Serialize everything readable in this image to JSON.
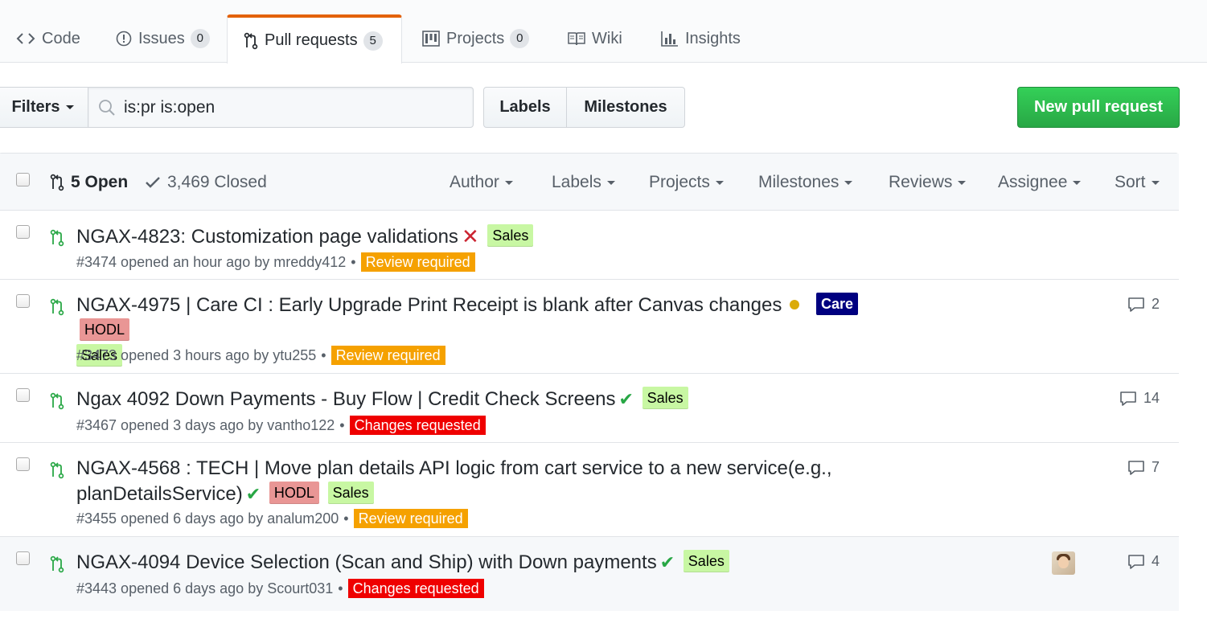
{
  "tabs": [
    {
      "label": "Code",
      "icon": "code-icon",
      "counter": null
    },
    {
      "label": "Issues",
      "icon": "issue-opened-icon",
      "counter": "0"
    },
    {
      "label": "Pull requests",
      "icon": "git-pull-request-icon",
      "counter": "5"
    },
    {
      "label": "Projects",
      "icon": "project-icon",
      "counter": "0"
    },
    {
      "label": "Wiki",
      "icon": "book-icon",
      "counter": null
    },
    {
      "label": "Insights",
      "icon": "graph-icon",
      "counter": null
    }
  ],
  "toolbar": {
    "filters_label": "Filters",
    "search_value": "is:pr is:open",
    "labels_label": "Labels",
    "milestones_label": "Milestones",
    "new_pr_label": "New pull request"
  },
  "list_header": {
    "open_label": "5 Open",
    "closed_label": "3,469 Closed",
    "menus": [
      "Author",
      "Labels",
      "Projects",
      "Milestones",
      "Reviews",
      "Assignee",
      "Sort"
    ]
  },
  "colors": {
    "tab_selected_border": "#e36209",
    "new_pr_green": "#28a745",
    "pr_open_green": "#28a745",
    "review_required": "#f5a100",
    "changes_requested": "#ef0000",
    "label_sales_bg": "#c8f7a3",
    "label_care_bg": "#000080",
    "label_hodl_bg": "#e99695"
  },
  "pull_requests": [
    {
      "title": "NGAX-4823: Customization page validations",
      "status": "failure",
      "labels": [
        "Sales"
      ],
      "meta": "#3474 opened an hour ago by mreddy412",
      "review": "Review required",
      "comments": null
    },
    {
      "title": "NGAX-4975 | Care CI : Early Upgrade Print Receipt is blank after Canvas changes",
      "status": "pending",
      "labels": [
        "Care",
        "HODL",
        "Sales"
      ],
      "meta": "#3473 opened 3 hours ago by ytu255",
      "review": "Review required",
      "comments": "2"
    },
    {
      "title": "Ngax 4092 Down Payments - Buy Flow | Credit Check Screens",
      "status": "success",
      "labels": [
        "Sales"
      ],
      "meta": "#3467 opened 3 days ago by vantho122",
      "review": "Changes requested",
      "comments": "14"
    },
    {
      "title": "NGAX-4568 : TECH | Move plan details API logic from cart service to a new service(e.g., planDetailsService)",
      "status": "success",
      "labels": [
        "HODL",
        "Sales"
      ],
      "meta": "#3455 opened 6 days ago by analum200",
      "review": "Review required",
      "comments": "7"
    },
    {
      "title": "NGAX-4094 Device Selection (Scan and Ship) with Down payments",
      "status": "success",
      "labels": [
        "Sales"
      ],
      "meta": "#3443 opened 6 days ago by Scourt031",
      "review": "Changes requested",
      "comments": "4"
    }
  ]
}
